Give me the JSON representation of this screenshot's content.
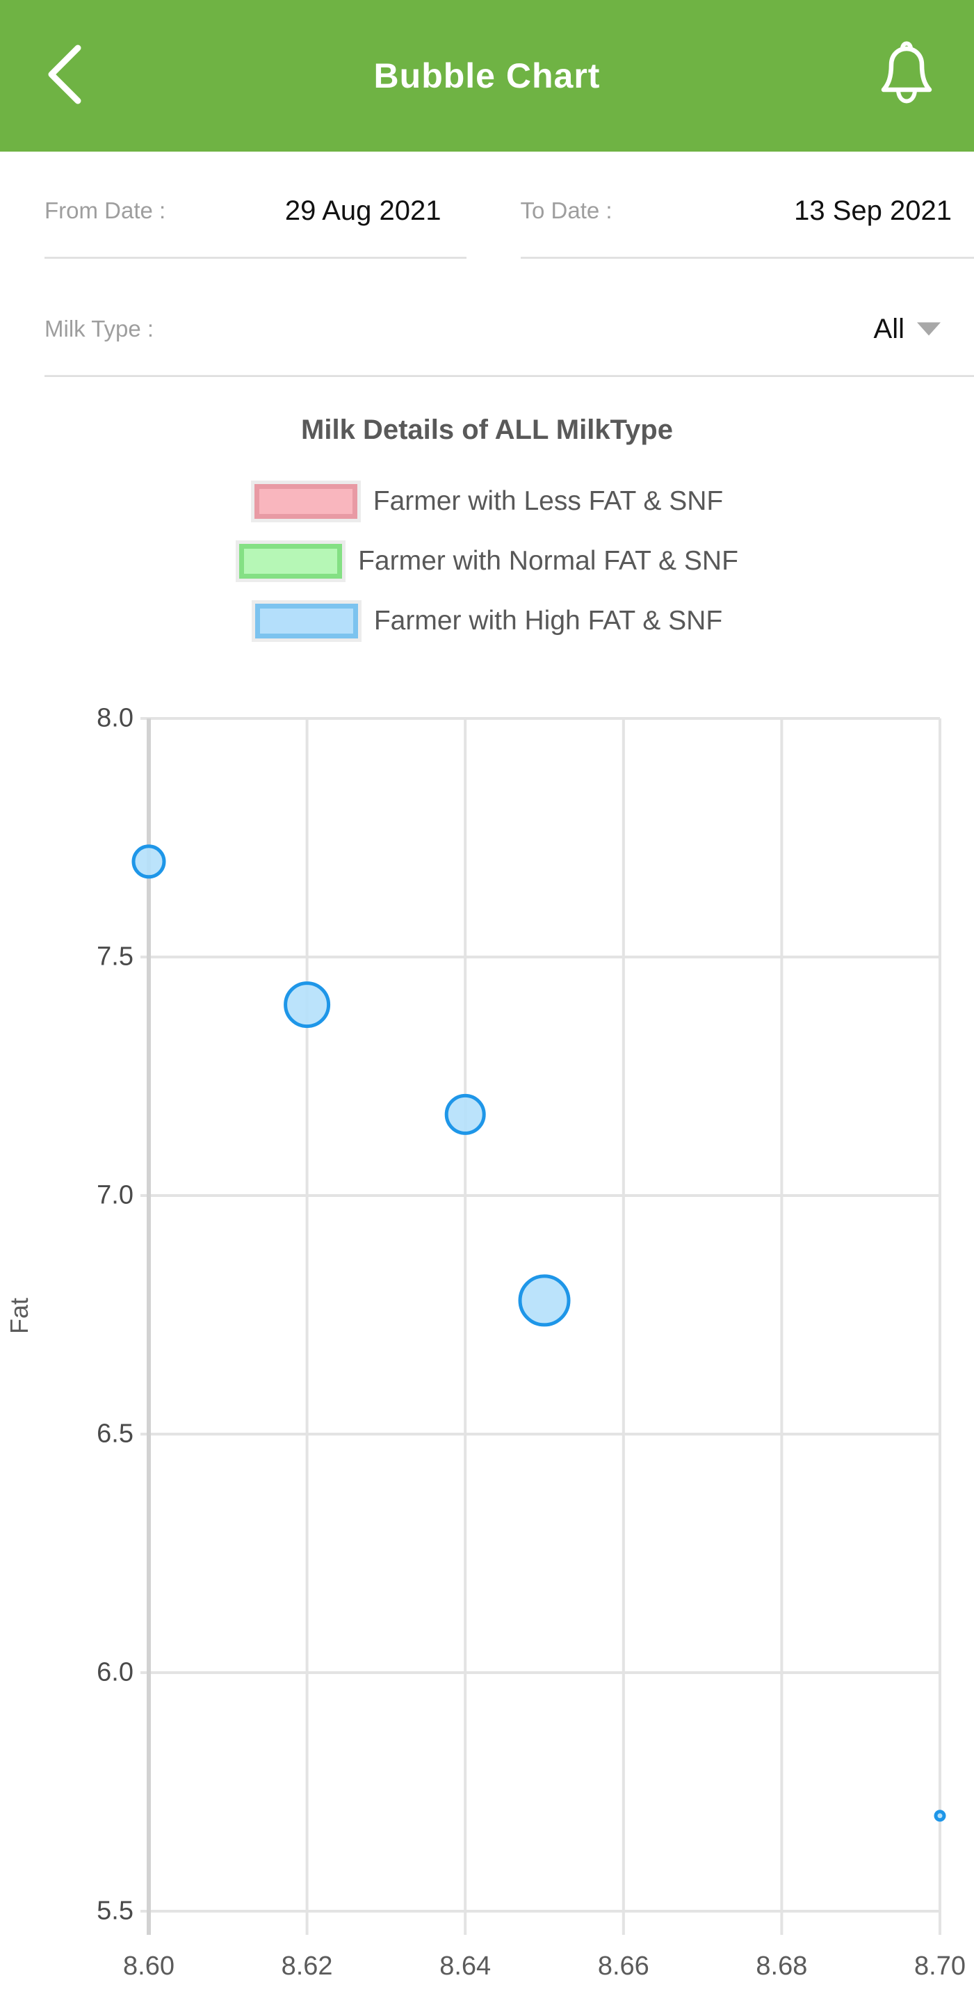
{
  "header": {
    "title": "Bubble Chart",
    "back_icon": "chevron-left-icon",
    "notification_icon": "bell-icon",
    "background_color": "#6fb344"
  },
  "filters": {
    "from_date": {
      "label": "From Date :",
      "value": "29 Aug 2021"
    },
    "to_date": {
      "label": "To Date :",
      "value": "13 Sep 2021"
    },
    "milk_type": {
      "label": "Milk Type :",
      "value": "All",
      "caret_icon": "chevron-down-icon"
    }
  },
  "chart_data": {
    "type": "scatter",
    "title": "Milk Details of ALL MilkType",
    "xlabel": "",
    "ylabel": "Fat",
    "xlim": [
      8.6,
      8.7
    ],
    "ylim": [
      5.5,
      8.0
    ],
    "xticks": [
      "8.60",
      "8.62",
      "8.64",
      "8.66",
      "8.68",
      "8.70"
    ],
    "xtick_values": [
      8.6,
      8.62,
      8.64,
      8.66,
      8.68,
      8.7
    ],
    "yticks": [
      "5.5",
      "6.0",
      "6.5",
      "7.0",
      "7.5",
      "8.0"
    ],
    "ytick_values": [
      5.5,
      6.0,
      6.5,
      7.0,
      7.5,
      8.0
    ],
    "grid": true,
    "legend_position": "top-center",
    "legend": [
      {
        "label": "Farmer with Less FAT & SNF",
        "fill": "#f9b6be",
        "border": "#e89aa4"
      },
      {
        "label": "Farmer with Normal FAT & SNF",
        "fill": "#b6f7b6",
        "border": "#84e084"
      },
      {
        "label": "Farmer with High FAT & SNF",
        "fill": "#b4dffb",
        "border": "#7cc3ef"
      }
    ],
    "series": [
      {
        "name": "Farmer with High FAT & SNF",
        "fill": "#b4e0fb",
        "stroke": "#1e96e8",
        "points": [
          {
            "x": 8.6,
            "y": 7.7,
            "r": 22
          },
          {
            "x": 8.62,
            "y": 7.4,
            "r": 31
          },
          {
            "x": 8.64,
            "y": 7.17,
            "r": 27
          },
          {
            "x": 8.65,
            "y": 6.78,
            "r": 35
          },
          {
            "x": 8.7,
            "y": 5.7,
            "r": 6
          }
        ]
      }
    ]
  }
}
